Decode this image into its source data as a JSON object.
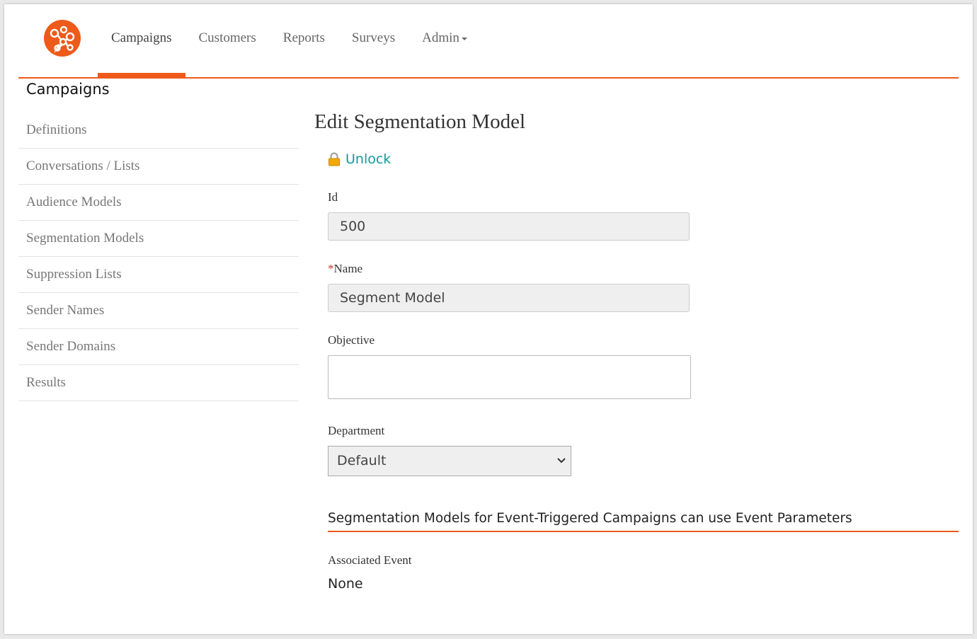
{
  "colors": {
    "accent": "#ee5a1a",
    "link": "#129a98"
  },
  "nav": {
    "logo_icon": "network-nodes-icon",
    "items": [
      {
        "label": "Campaigns",
        "active": true
      },
      {
        "label": "Customers"
      },
      {
        "label": "Reports"
      },
      {
        "label": "Surveys"
      },
      {
        "label": "Admin",
        "dropdown": true
      }
    ]
  },
  "sidebar": {
    "title": "Campaigns",
    "items": [
      {
        "label": "Definitions"
      },
      {
        "label": "Conversations / Lists"
      },
      {
        "label": "Audience Models"
      },
      {
        "label": "Segmentation Models"
      },
      {
        "label": "Suppression Lists"
      },
      {
        "label": "Sender Names"
      },
      {
        "label": "Sender Domains"
      },
      {
        "label": "Results"
      }
    ]
  },
  "main": {
    "title": "Edit Segmentation Model",
    "unlock": {
      "label": "Unlock",
      "icon": "lock-icon"
    },
    "fields": {
      "id": {
        "label": "Id",
        "value": "500"
      },
      "name": {
        "required_mark": "*",
        "label": "Name",
        "value": "Segment Model"
      },
      "objective": {
        "label": "Objective",
        "value": ""
      },
      "department": {
        "label": "Department",
        "value": "Default"
      }
    },
    "section": {
      "heading": "Segmentation Models for Event-Triggered Campaigns can use Event Parameters",
      "associated_event_label": "Associated Event",
      "associated_event_value": "None"
    }
  }
}
